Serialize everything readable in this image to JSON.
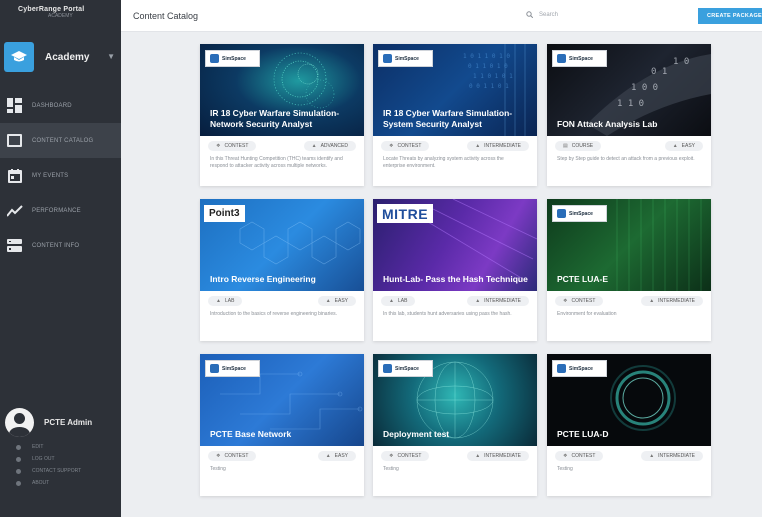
{
  "brand": {
    "title": "CyberRange Portal",
    "subtitle": "ACADEMY"
  },
  "academy": {
    "label": "Academy"
  },
  "nav": [
    {
      "label": "DASHBOARD"
    },
    {
      "label": "CONTENT CATALOG"
    },
    {
      "label": "MY EVENTS"
    },
    {
      "label": "PERFORMANCE"
    },
    {
      "label": "CONTENT INFO"
    }
  ],
  "user": {
    "name": "PCTE Admin",
    "links": [
      "EDIT",
      "LOG OUT",
      "CONTACT SUPPORT",
      "ABOUT"
    ]
  },
  "topbar": {
    "title": "Content Catalog",
    "search_placeholder": "Search",
    "create_label": "CREATE PACKAGE"
  },
  "colors": {
    "accent": "#3aa0de",
    "sidebar": "#2d3138"
  },
  "cards": [
    {
      "title": "IR 18 Cyber Warfare Simulation- Network Security Analyst",
      "logo": "SimSpace",
      "type": "CONTEST",
      "level": "ADVANCED",
      "desc": "In this Threat Hunting Competition (THC) teams identify and respond to attacker activity across multiple networks.",
      "art": "neural"
    },
    {
      "title": "IR 18 Cyber Warfare Simulation- System Security Analyst",
      "logo": "SimSpace",
      "type": "CONTEST",
      "level": "INTERMEDIATE",
      "desc": "Locate Threats by analyzing system activity across the enterprise environment.",
      "art": "binary-blue"
    },
    {
      "title": "FON Attack Analysis Lab",
      "logo": "SimSpace",
      "type": "COURSE",
      "level": "EASY",
      "desc": "Step by Step guide to detect an attack from a previous exploit.",
      "art": "binary-dark"
    },
    {
      "title": "Intro Reverse Engineering",
      "logo": "Point3",
      "type": "LAB",
      "level": "EASY",
      "desc": "Introduction to the basics of reverse engineering binaries.",
      "art": "hex"
    },
    {
      "title": "Hunt-Lab- Pass the Hash Technique",
      "logo": "MITRE",
      "type": "LAB",
      "level": "INTERMEDIATE",
      "desc": "In this lab, students hunt adversaries using pass the hash.",
      "art": "purple"
    },
    {
      "title": "PCTE LUA-E",
      "logo": "SimSpace",
      "type": "CONTEST",
      "level": "INTERMEDIATE",
      "desc": "Environment for evaluation",
      "art": "matrix"
    },
    {
      "title": "PCTE Base Network",
      "logo": "SimSpace",
      "type": "CONTEST",
      "level": "EASY",
      "desc": "Testing",
      "art": "circuit"
    },
    {
      "title": "Deployment test",
      "logo": "SimSpace",
      "type": "CONTEST",
      "level": "INTERMEDIATE",
      "desc": "Testing",
      "art": "globe"
    },
    {
      "title": "PCTE LUA-D",
      "logo": "SimSpace",
      "type": "CONTEST",
      "level": "INTERMEDIATE",
      "desc": "Testing",
      "art": "ring"
    }
  ]
}
